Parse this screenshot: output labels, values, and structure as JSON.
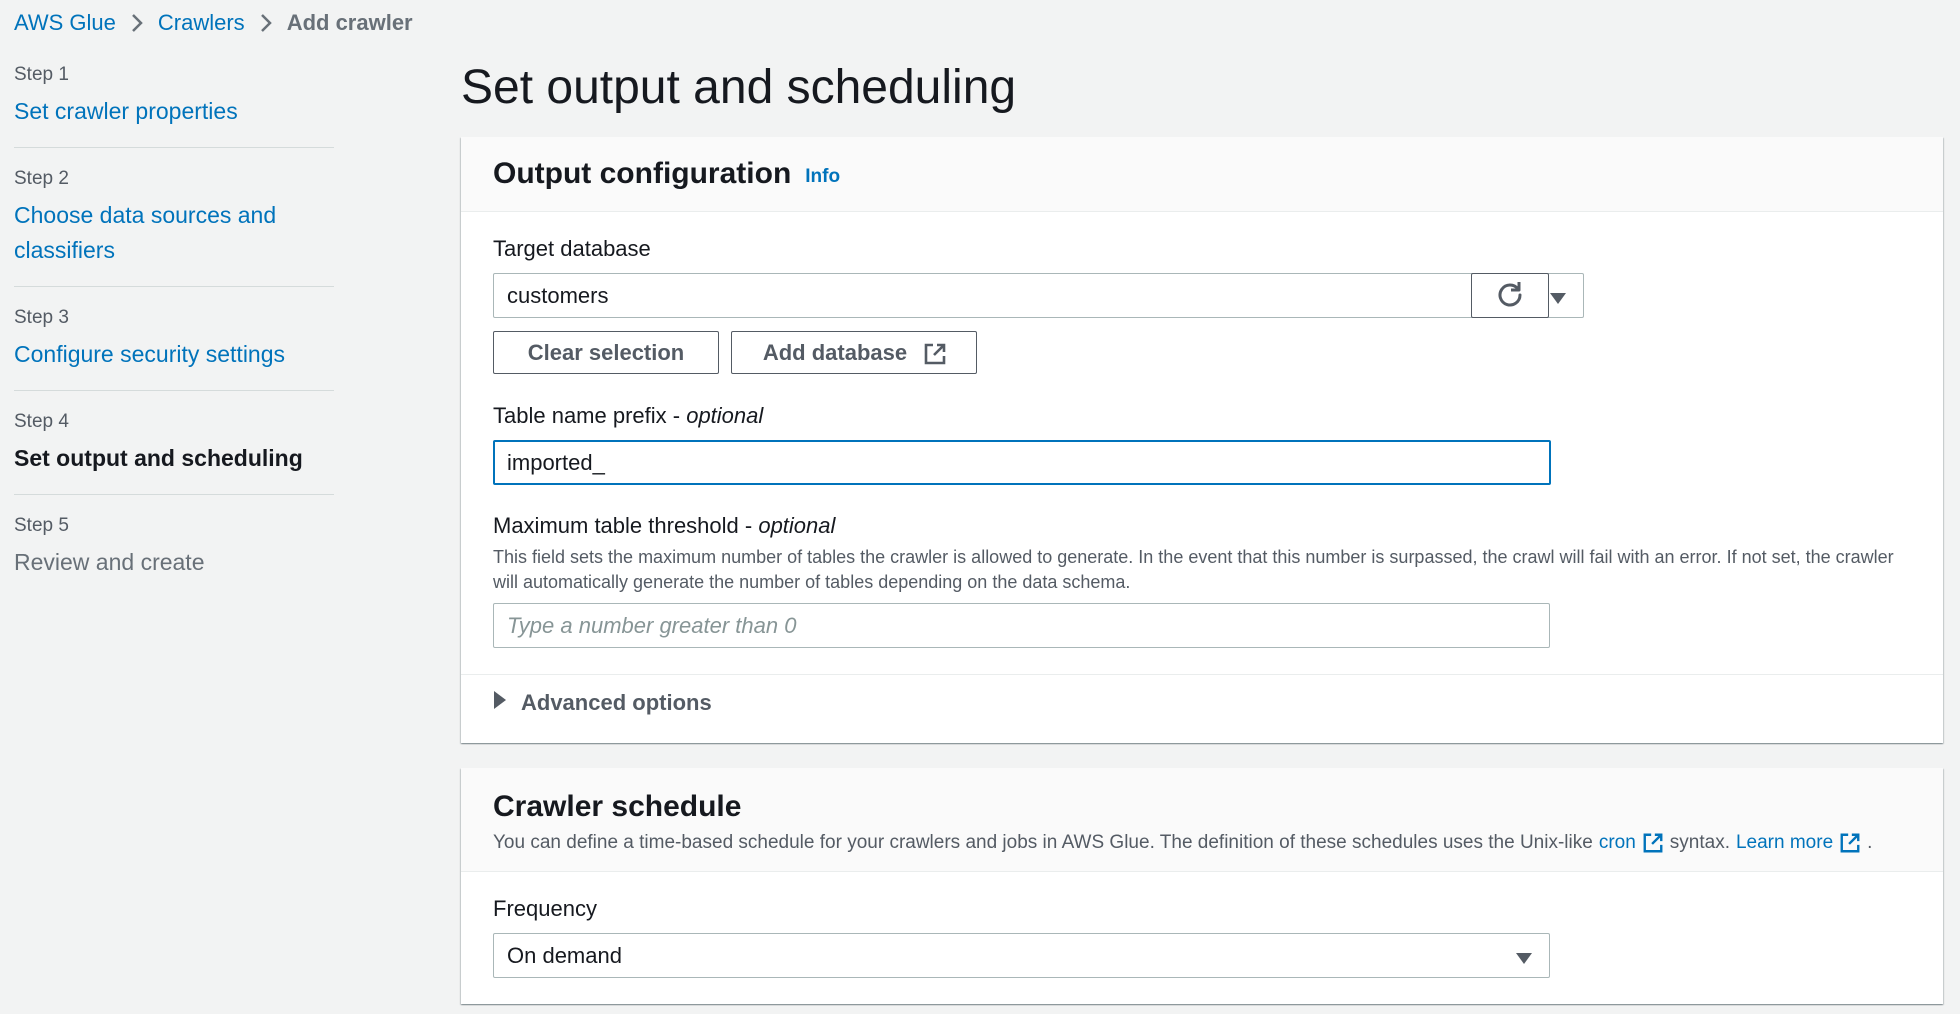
{
  "breadcrumb": {
    "items": [
      "AWS Glue",
      "Crawlers"
    ],
    "current": "Add crawler"
  },
  "steps": [
    {
      "num": "Step 1",
      "title": "Set crawler properties"
    },
    {
      "num": "Step 2",
      "title": "Choose data sources and classifiers"
    },
    {
      "num": "Step 3",
      "title": "Configure security settings"
    },
    {
      "num": "Step 4",
      "title": "Set output and scheduling"
    },
    {
      "num": "Step 5",
      "title": "Review and create"
    }
  ],
  "page": {
    "title": "Set output and scheduling"
  },
  "output": {
    "title": "Output configuration",
    "info": "Info",
    "target_db_label": "Target database",
    "target_db_value": "customers",
    "clear_selection": "Clear selection",
    "add_database": "Add database",
    "prefix_label": "Table name prefix - ",
    "prefix_optional": "optional",
    "prefix_value": "imported_",
    "threshold_label": "Maximum table threshold - ",
    "threshold_optional": "optional",
    "threshold_desc": "This field sets the maximum number of tables the crawler is allowed to generate. In the event that this number is surpassed, the crawl will fail with an error. If not set, the crawler will automatically generate the number of tables depending on the data schema.",
    "threshold_placeholder": "Type a number greater than 0",
    "advanced": "Advanced options"
  },
  "schedule": {
    "title": "Crawler schedule",
    "desc_before": "You can define a time-based schedule for your crawlers and jobs in AWS Glue. The definition of these schedules uses the Unix-like",
    "cron_link": "cron",
    "desc_mid": "syntax.",
    "learn_more": "Learn more",
    "desc_end": ".",
    "frequency_label": "Frequency",
    "frequency_value": "On demand"
  },
  "colors": {
    "link": "#0073bb",
    "focus": "#0073bb",
    "background": "#f2f3f3"
  }
}
